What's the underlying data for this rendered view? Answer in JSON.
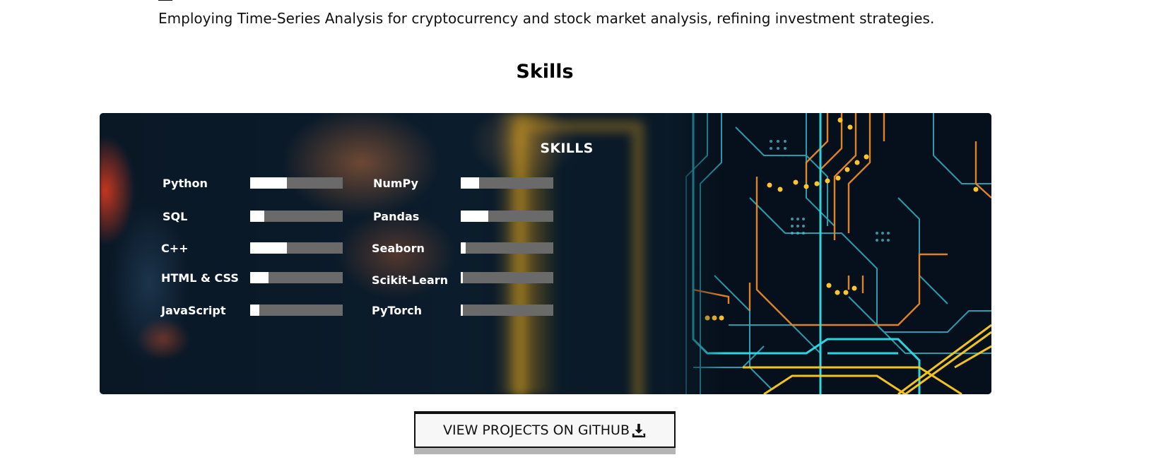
{
  "intro": {
    "text": "Employing Time-Series Analysis for cryptocurrency and stock market analysis, refining investment strategies."
  },
  "section": {
    "heading": "Skills"
  },
  "skills_card": {
    "title": "SKILLS",
    "left_column": [
      {
        "label": "Python",
        "level": 0.4
      },
      {
        "label": "SQL",
        "level": 0.15
      },
      {
        "label": "C++",
        "level": 0.4
      },
      {
        "label": "HTML & CSS",
        "level": 0.2
      },
      {
        "label": "JavaScript",
        "level": 0.1
      }
    ],
    "right_column": [
      {
        "label": "NumPy",
        "level": 0.2
      },
      {
        "label": "Pandas",
        "level": 0.3
      },
      {
        "label": "Seaborn",
        "level": 0.05
      },
      {
        "label": "Scikit-Learn",
        "level": 0.02
      },
      {
        "label": "PyTorch",
        "level": 0.02
      }
    ]
  },
  "github_button": {
    "label": "VIEW PROJECTS ON GITHUB",
    "icon": "download-icon"
  },
  "colors": {
    "bar_fill": "#ffffff",
    "bar_track": "#6a6a6a",
    "card_bg": "#071525",
    "circuit_cyan": "#3fd0d8",
    "circuit_orange": "#e8882a",
    "circuit_yellow": "#ffd21f"
  }
}
